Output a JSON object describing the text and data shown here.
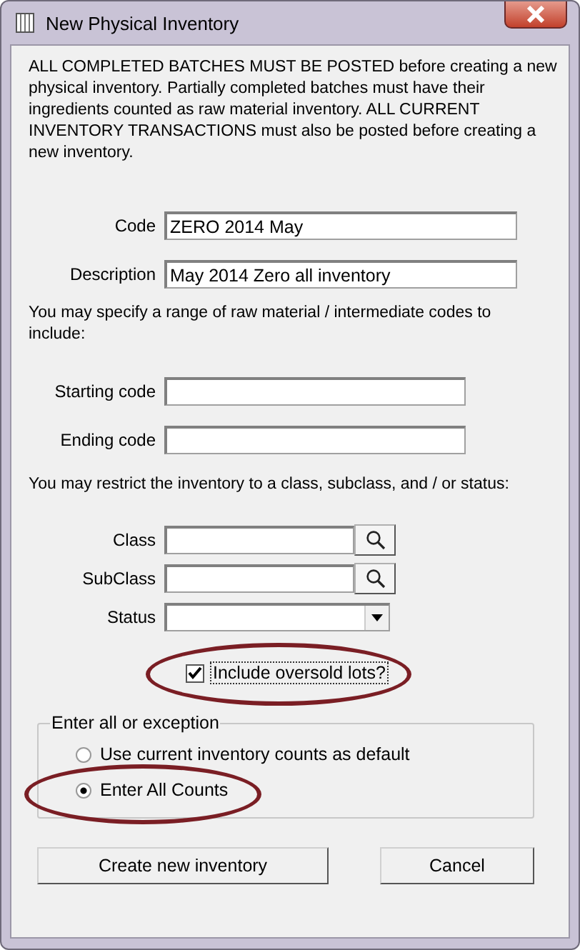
{
  "window": {
    "title": "New Physical Inventory"
  },
  "intro": "ALL COMPLETED BATCHES MUST BE POSTED before creating a new physical inventory.  Partially completed batches must have their ingredients counted as raw material inventory.   ALL CURRENT INVENTORY TRANSACTIONS must also be posted before creating a new inventory.",
  "code": {
    "label": "Code",
    "value": "ZERO 2014 May"
  },
  "description": {
    "label": "Description",
    "value": "May 2014 Zero all inventory"
  },
  "range_note": "You may specify a range of raw material / intermediate codes to include:",
  "starting_code": {
    "label": "Starting code"
  },
  "ending_code": {
    "label": "Ending code"
  },
  "restrict_note": "You may restrict the inventory to a class, subclass, and / or status:",
  "filters": [
    {
      "kind": "lookup",
      "label": "Class"
    },
    {
      "kind": "lookup",
      "label": "SubClass"
    },
    {
      "kind": "dropdown",
      "label": "Status"
    }
  ],
  "include_oversold": {
    "label": "Include oversold lots?",
    "checked": true,
    "circled": true
  },
  "entry_group": {
    "title": "Enter all or exception",
    "options": [
      {
        "label": "Use current inventory counts as default",
        "selected": false,
        "circled": false
      },
      {
        "label": "Enter All Counts",
        "selected": true,
        "circled": true
      }
    ]
  },
  "buttons": [
    {
      "label": "Create new inventory"
    },
    {
      "label": "Cancel"
    }
  ]
}
